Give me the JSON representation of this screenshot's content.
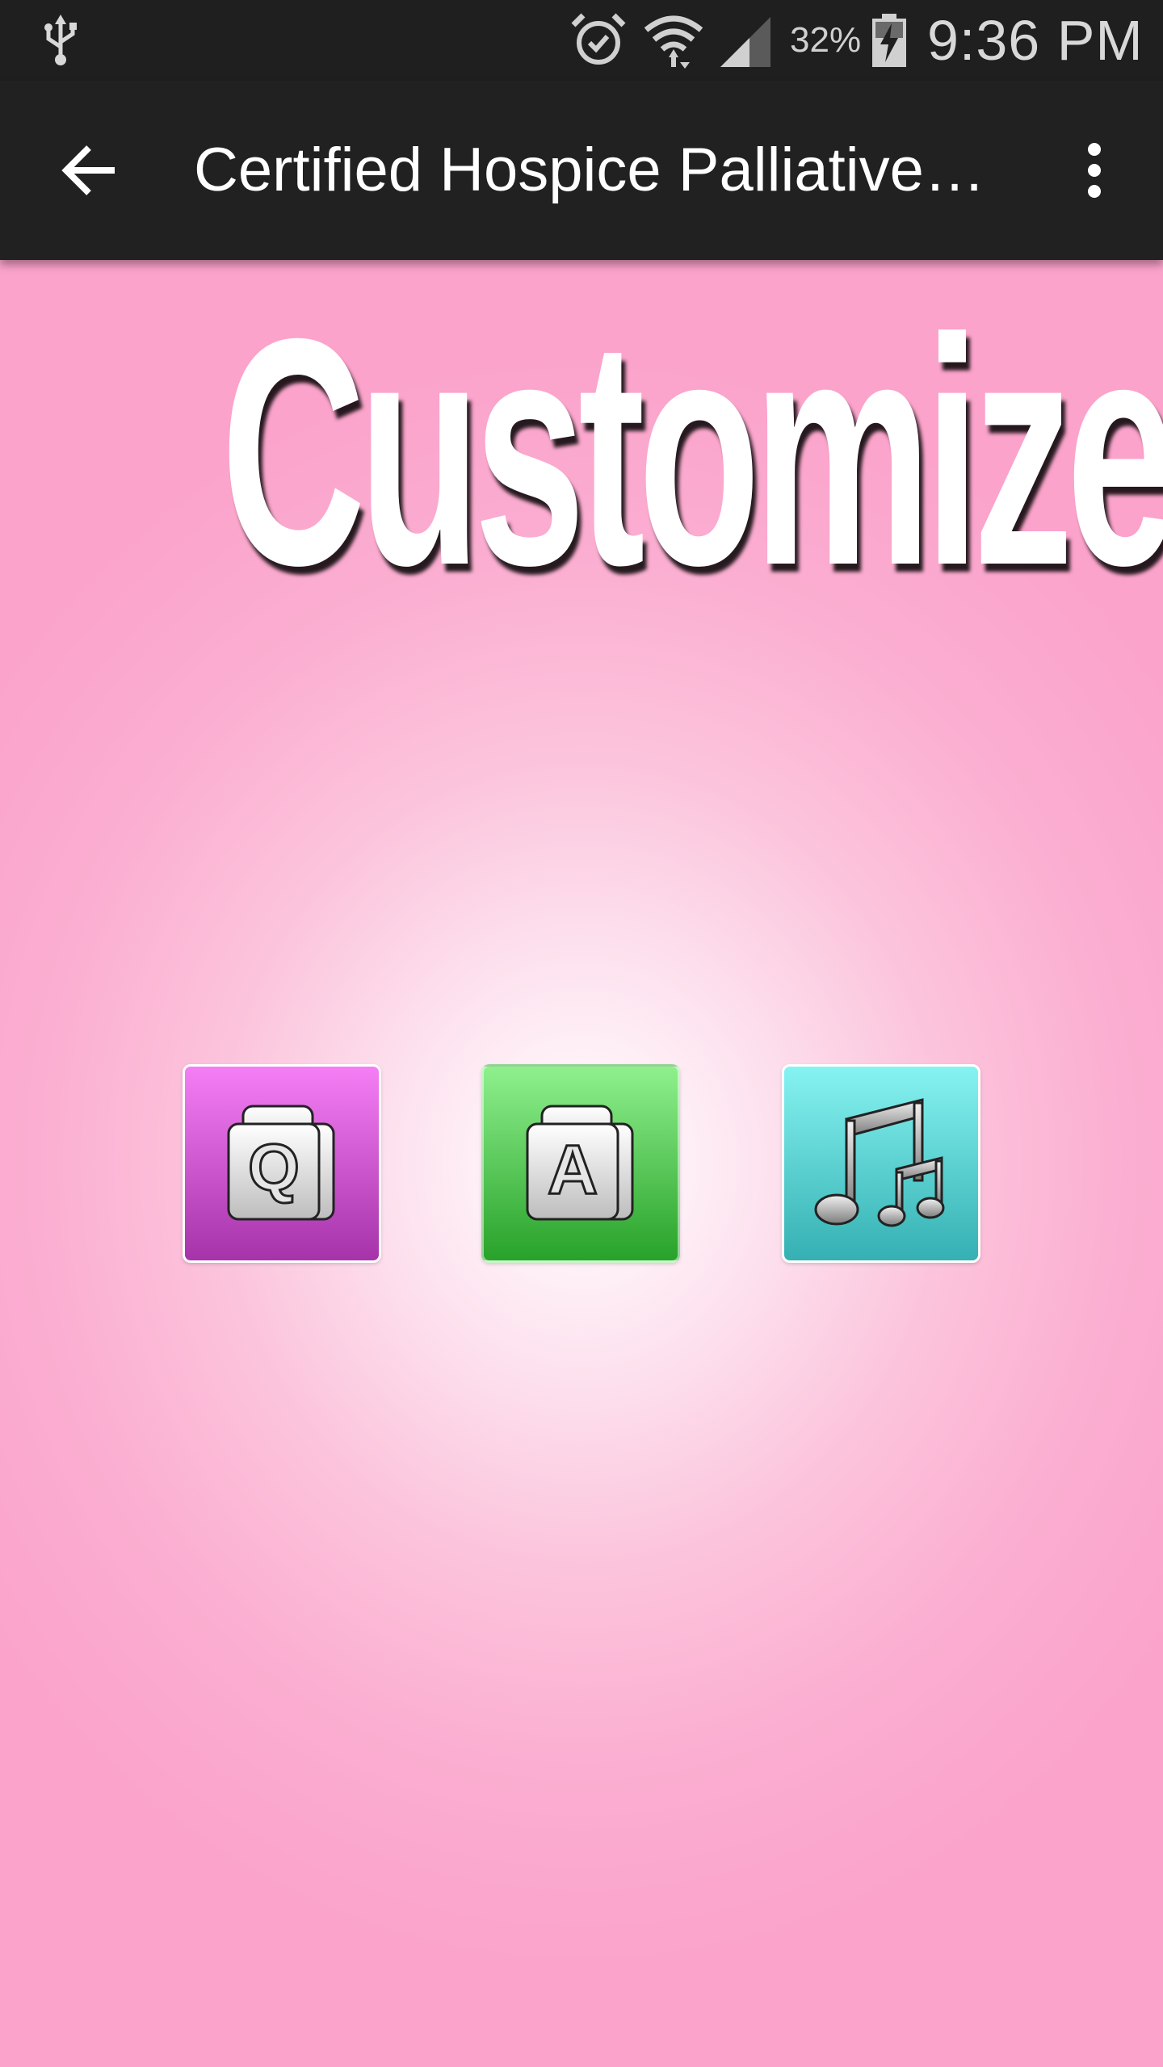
{
  "status_bar": {
    "battery_percent": "32%",
    "time": "9:36 PM",
    "icons": [
      "usb-icon",
      "alarm-icon",
      "wifi-icon",
      "signal-icon",
      "battery-charging-icon"
    ]
  },
  "app_bar": {
    "title": "Certified Hospice Palliative…",
    "back_icon": "arrow-left-icon",
    "menu_icon": "overflow-menu-icon"
  },
  "main": {
    "heading": "Customize",
    "buttons": [
      {
        "name": "questions",
        "letter": "Q",
        "color": "#c84cc9"
      },
      {
        "name": "answers",
        "letter": "A",
        "color": "#49c547"
      },
      {
        "name": "music",
        "icon": "music-note-icon",
        "color": "#58cfd1"
      }
    ]
  },
  "colors": {
    "status_bar": "#1f1f1f",
    "app_bar": "#212121",
    "background_edge": "#fba3cb",
    "background_center": "#ffffff"
  }
}
